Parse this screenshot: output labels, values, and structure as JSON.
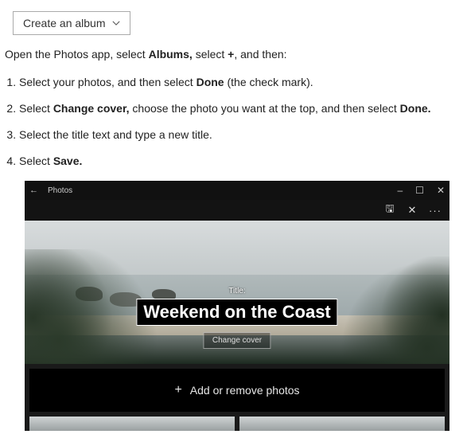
{
  "dropdown": {
    "label": "Create an album"
  },
  "intro": {
    "pre": "Open the Photos app, select ",
    "bold1": "Albums,",
    "mid": " select ",
    "bold2": "+",
    "post": ", and then:"
  },
  "steps": [
    {
      "pre": "Select your photos, and then select ",
      "bold1": "Done",
      "post": " (the check mark)."
    },
    {
      "pre": "Select ",
      "bold1": "Change cover,",
      "mid": " choose the photo you want at the top, and then select ",
      "bold2": "Done.",
      "post": ""
    },
    {
      "pre": "Select the title text and type a new title.",
      "bold1": "",
      "post": ""
    },
    {
      "pre": "Select ",
      "bold1": "Save.",
      "post": ""
    }
  ],
  "app": {
    "titlebar": {
      "back": "←",
      "name": "Photos",
      "min": "–",
      "max": "☐",
      "close": "✕"
    },
    "toolbar": {
      "save_icon": "🖫",
      "close_icon": "✕",
      "more_icon": "···"
    },
    "cover": {
      "title_label": "Title:",
      "album_title": "Weekend on the Coast",
      "change_cover": "Change cover"
    },
    "addbar": {
      "plus": "+",
      "label": "Add or remove photos"
    }
  }
}
